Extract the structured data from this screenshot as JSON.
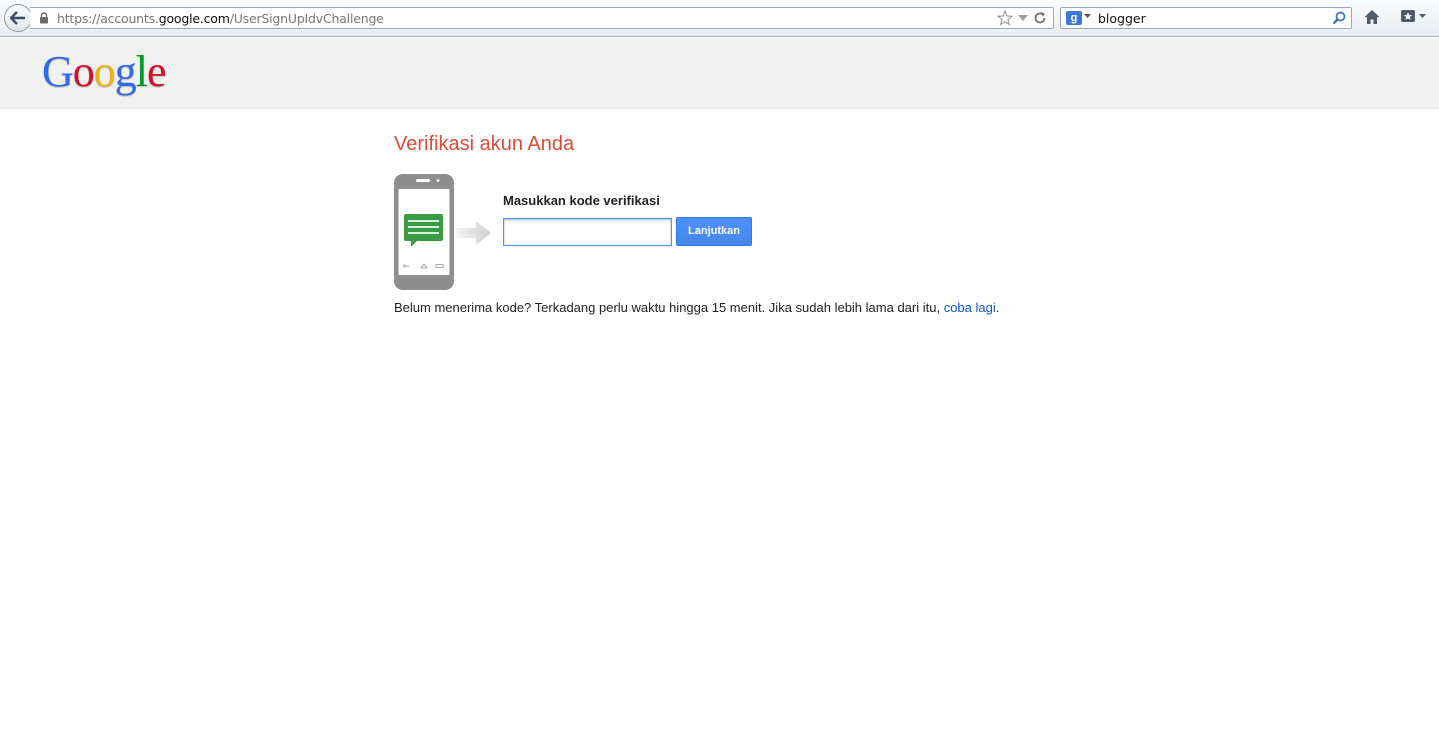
{
  "browser": {
    "url_prefix": "https://accounts.",
    "url_domain": "google.com",
    "url_path": "/UserSignUpIdvChallenge",
    "search_engine_letter": "g",
    "search_query": "blogger"
  },
  "page": {
    "heading": "Verifikasi akun Anda",
    "code_label": "Masukkan kode verifikasi",
    "code_value": "",
    "continue_label": "Lanjutkan",
    "help_text": "Belum menerima kode? Terkadang perlu waktu hingga 15 menit. Jika sudah lebih lama dari itu, ",
    "retry_link": "coba lagi",
    "help_suffix": "."
  },
  "logo": {
    "letters": [
      "G",
      "o",
      "o",
      "g",
      "l",
      "e"
    ],
    "colors": [
      "#3369e8",
      "#d50f25",
      "#eeb211",
      "#3369e8",
      "#009925",
      "#d50f25"
    ]
  },
  "colors": {
    "heading": "#dd4b39",
    "button": "#4d90fe",
    "link": "#1155cc",
    "sms_bubble": "#3a9a46"
  }
}
